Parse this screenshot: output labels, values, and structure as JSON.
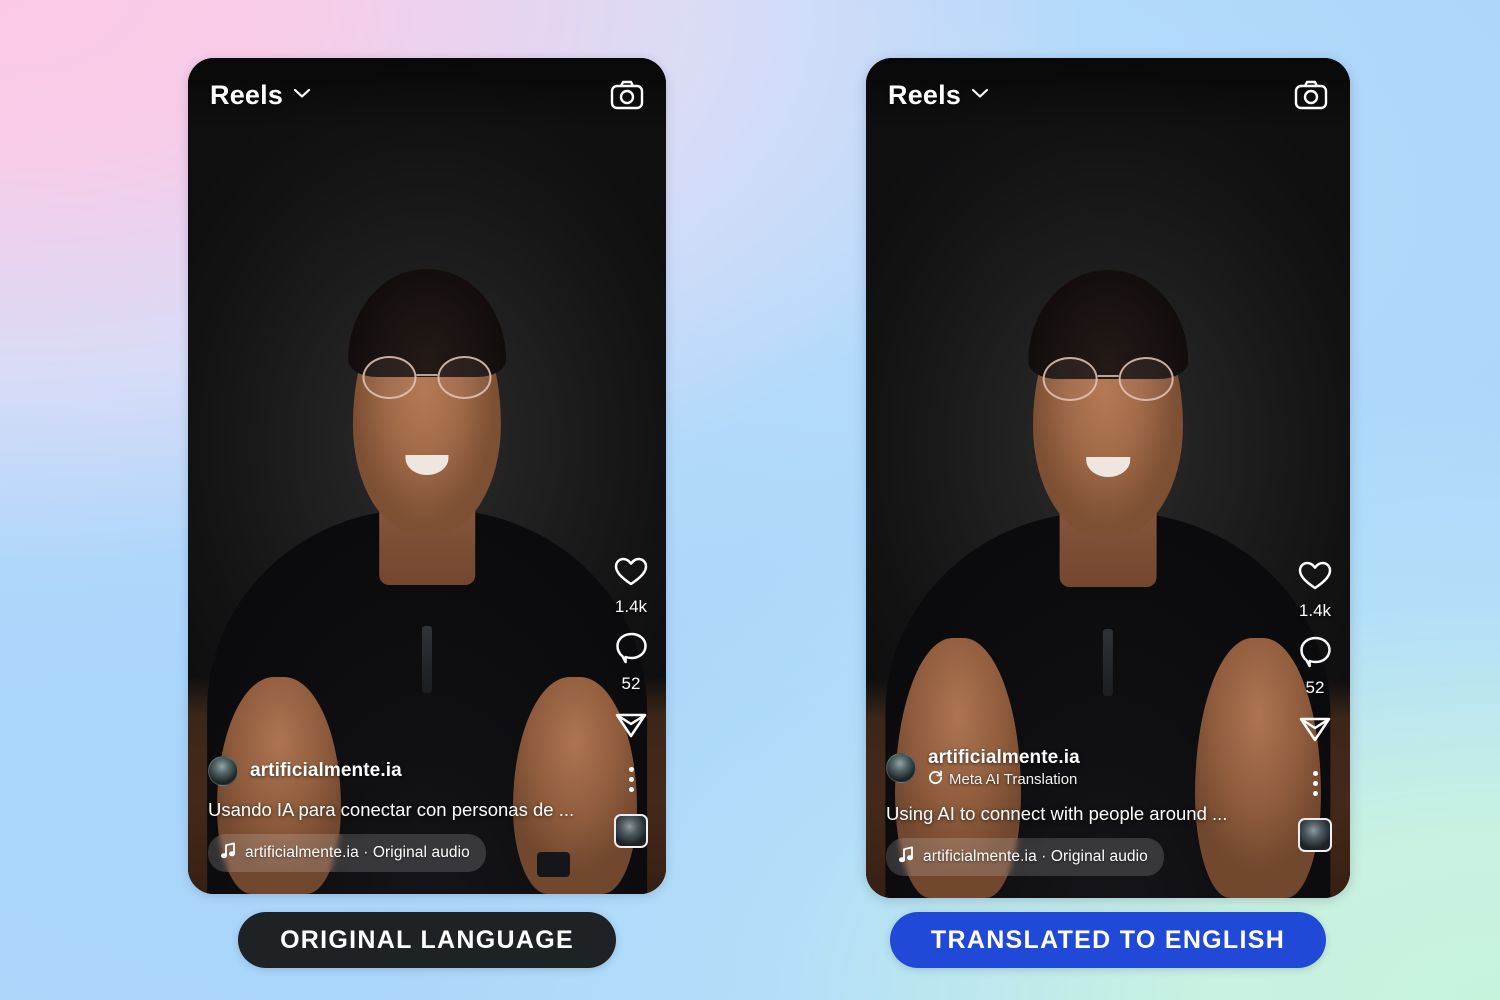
{
  "background": {
    "gradient_colors": [
      "#f8c8e7",
      "#b3d9fb",
      "#aed9fb",
      "#c6f2de"
    ]
  },
  "panels": [
    {
      "id": "original",
      "header": {
        "title": "Reels",
        "chevron_icon": "chevron-down-icon",
        "camera_icon": "camera-icon"
      },
      "actions": {
        "like_icon": "heart-icon",
        "like_count": "1.4k",
        "comment_icon": "comment-icon",
        "comment_count": "52",
        "share_icon": "send-icon",
        "more_icon": "more-options-icon",
        "thumbnail_icon": "audio-thumbnail"
      },
      "caption": {
        "avatar_icon": "avatar",
        "username": "artificialmente.ia",
        "translation_badge": null,
        "translation_badge_icon": null,
        "text": "Usando IA para conectar con personas de ...",
        "audio_icon": "music-note-icon",
        "audio_label": "artificialmente.ia · Original audio"
      },
      "label_button": {
        "text": "ORIGINAL LANGUAGE",
        "background": "#1f2225",
        "text_color": "#ffffff"
      },
      "border": {
        "type": "plain",
        "color": "#161616"
      }
    },
    {
      "id": "translated",
      "header": {
        "title": "Reels",
        "chevron_icon": "chevron-down-icon",
        "camera_icon": "camera-icon"
      },
      "actions": {
        "like_icon": "heart-icon",
        "like_count": "1.4k",
        "comment_icon": "comment-icon",
        "comment_count": "52",
        "share_icon": "send-icon",
        "more_icon": "more-options-icon",
        "thumbnail_icon": "audio-thumbnail"
      },
      "caption": {
        "avatar_icon": "avatar",
        "username": "artificialmente.ia",
        "translation_badge": "Meta AI Translation",
        "translation_badge_icon": "translate-refresh-icon",
        "text": "Using AI to connect with people around ...",
        "audio_icon": "music-note-icon",
        "audio_label": "artificialmente.ia · Original audio"
      },
      "label_button": {
        "text": "TRANSLATED TO ENGLISH",
        "background": "#1f49d6",
        "text_color": "#ffffff"
      },
      "border": {
        "type": "gradient",
        "colors": [
          "#f7e96a",
          "#f5c06a",
          "#f07aa8",
          "#e055c6",
          "#a64fe0",
          "#2b7bf5",
          "#2ec7e8",
          "#4fe39a",
          "#9ae060"
        ]
      }
    }
  ]
}
